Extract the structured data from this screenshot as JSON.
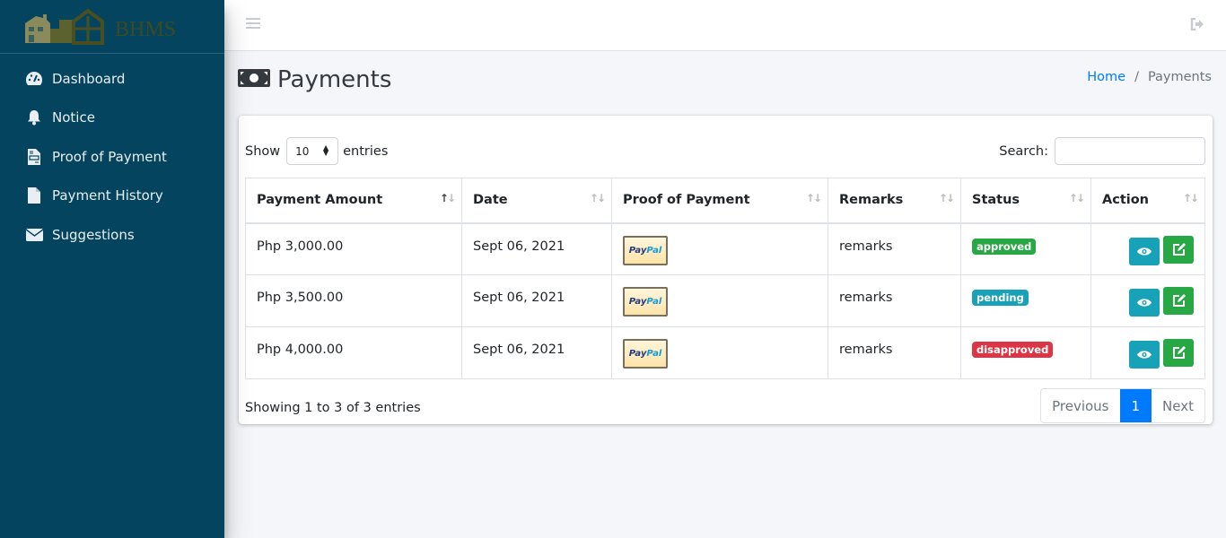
{
  "brand": {
    "name": "BHMS"
  },
  "sidebar": {
    "items": [
      {
        "label": "Dashboard",
        "icon": "tachometer-icon"
      },
      {
        "label": "Notice",
        "icon": "bell-icon"
      },
      {
        "label": "Proof of Payment",
        "icon": "file-invoice-icon"
      },
      {
        "label": "Payment History",
        "icon": "file-icon"
      },
      {
        "label": "Suggestions",
        "icon": "envelope-icon"
      }
    ]
  },
  "topbar": {
    "menu_icon": "bars-icon",
    "logout_icon": "sign-out-icon"
  },
  "page": {
    "title": "Payments",
    "title_icon": "money-bill-icon"
  },
  "breadcrumb": {
    "home": "Home",
    "separator": "/",
    "current": "Payments"
  },
  "table_controls": {
    "show_label": "Show",
    "entries_value": "10",
    "entries_label": "entries",
    "search_label": "Search:",
    "search_value": ""
  },
  "table": {
    "columns": [
      "Payment Amount",
      "Date",
      "Proof of Payment",
      "Remarks",
      "Status",
      "Action"
    ],
    "rows": [
      {
        "amount": "Php 3,000.00",
        "date": "Sept 06, 2021",
        "proof": "PayPal",
        "remarks": "remarks",
        "status": "approved",
        "status_color": "#28a745"
      },
      {
        "amount": "Php 3,500.00",
        "date": "Sept 06, 2021",
        "proof": "PayPal",
        "remarks": "remarks",
        "status": "pending",
        "status_color": "#17a2b8"
      },
      {
        "amount": "Php 4,000.00",
        "date": "Sept 06, 2021",
        "proof": "PayPal",
        "remarks": "remarks",
        "status": "disapproved",
        "status_color": "#dc3545"
      }
    ]
  },
  "footer": {
    "info": "Showing 1 to 3 of 3 entries",
    "previous": "Previous",
    "current_page": "1",
    "next": "Next"
  },
  "colors": {
    "sidebar": "#05445e",
    "primary": "#007bff",
    "info": "#17a2b8",
    "success": "#28a745",
    "danger": "#dc3545"
  }
}
